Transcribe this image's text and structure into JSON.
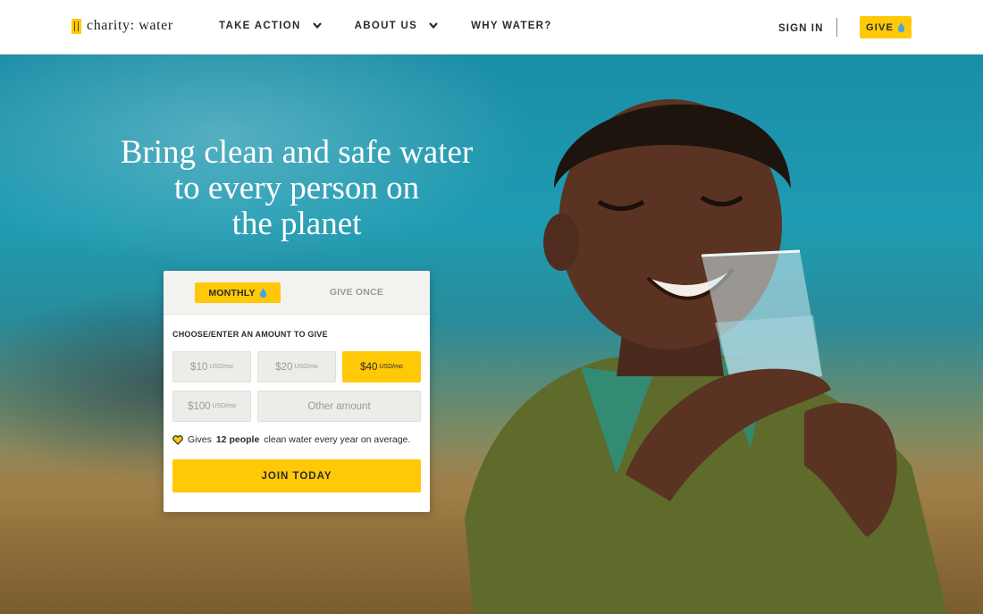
{
  "header": {
    "logo_text": "charity: water",
    "nav": [
      {
        "label": "TAKE ACTION",
        "has_dropdown": true
      },
      {
        "label": "ABOUT US",
        "has_dropdown": true
      },
      {
        "label": "WHY WATER?",
        "has_dropdown": false
      }
    ],
    "sign_in": "SIGN IN",
    "give": "GIVE"
  },
  "hero": {
    "headline_lines": [
      "Bring clean and safe water",
      "to every person on",
      "the planet"
    ]
  },
  "donation": {
    "tabs": {
      "monthly": "MONTHLY",
      "once": "GIVE ONCE",
      "active": "monthly"
    },
    "prompt": "CHOOSE/ENTER AN AMOUNT TO GIVE",
    "amounts": [
      {
        "value": "$10",
        "unit": "USD/mo",
        "selected": false
      },
      {
        "value": "$20",
        "unit": "USD/mo",
        "selected": false
      },
      {
        "value": "$40",
        "unit": "USD/mo",
        "selected": true
      },
      {
        "value": "$100",
        "unit": "USD/mo",
        "selected": false
      }
    ],
    "other_amount_placeholder": "Other amount",
    "impact": {
      "prefix": "Gives",
      "count": "12 people",
      "suffix": "clean water every year on average."
    },
    "cta": "JOIN TODAY"
  },
  "colors": {
    "accent": "#ffc907",
    "text": "#2b2b2b",
    "drop": "#4aa3df"
  },
  "icons": [
    "logo-jerrycan-icon",
    "chevron-down-icon",
    "water-drop-icon",
    "heart-icon"
  ]
}
